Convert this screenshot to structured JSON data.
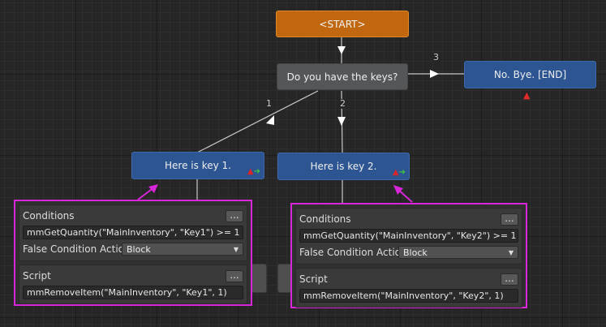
{
  "nodes": {
    "start": "<START>",
    "question": "Do you have the keys?",
    "end": "No. Bye. [END]",
    "key1": "Here is key 1.",
    "key2": "Here is key 2."
  },
  "edges": {
    "e1": "1",
    "e2": "2",
    "e3": "3"
  },
  "icons": {
    "link_up": "red-up-arrow-icon",
    "link_right": "green-right-arrow-icon",
    "marker": "red-triangle-marker-icon",
    "more": "ellipsis-icon",
    "dropdown": "chevron-down-icon"
  },
  "glyphs": {
    "up": "▲",
    "right": "➜",
    "caret": "▼",
    "dots": "..."
  },
  "panels": [
    {
      "conditions_label": "Conditions",
      "condition_value": "mmGetQuantity(\"MainInventory\", \"Key1\") >= 1",
      "false_action_label": "False Condition Actio",
      "false_action_value": "Block",
      "script_label": "Script",
      "script_value": "mmRemoveItem(\"MainInventory\", \"Key1\", 1)"
    },
    {
      "conditions_label": "Conditions",
      "condition_value": "mmGetQuantity(\"MainInventory\", \"Key2\") >= 1",
      "false_action_label": "False Condition Actio",
      "false_action_value": "Block",
      "script_label": "Script",
      "script_value": "mmRemoveItem(\"MainInventory\", \"Key2\", 1)"
    }
  ],
  "colors": {
    "start_node": "#c0670f",
    "dialogue_node": "#555658",
    "response_node": "#2c5592",
    "highlight": "#d826d8",
    "link_arrow": "#ffffff"
  }
}
